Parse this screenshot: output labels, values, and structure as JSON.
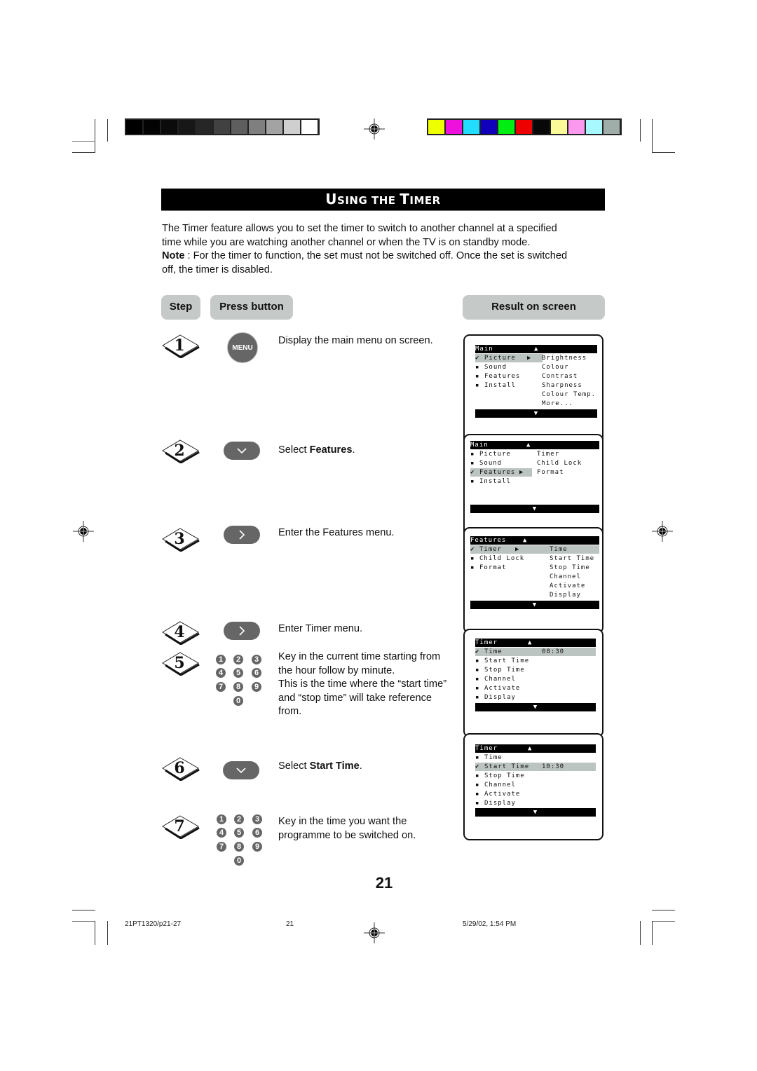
{
  "print_marks": {
    "grayscale_swatches": [
      "#000000",
      "#030303",
      "#0b0b0b",
      "#171717",
      "#262626",
      "#414141",
      "#5e5e5e",
      "#7f7f7f",
      "#a3a3a3",
      "#cfcfcf",
      "#ffffff"
    ],
    "color_swatches": [
      "#eeff00",
      "#ee11dd",
      "#22ddff",
      "#1100bb",
      "#00ee11",
      "#ee0000",
      "#080808",
      "#fafa99",
      "#fa99ee",
      "#a8f8ff",
      "#a0aeaa"
    ]
  },
  "title": {
    "first_cap": "U",
    "first_rest": "SING THE ",
    "second_cap": "T",
    "second_rest": "IMER"
  },
  "intro": {
    "line1": "The Timer feature allows you to set the timer to switch to another channel at a specified",
    "line2": "time while you are watching another channel or when the TV is on standby mode.",
    "note_label": "Note",
    "note_text": " : For the timer to function, the set must not be switched off. Once the set is switched",
    "line4": "off, the timer is disabled."
  },
  "headers": {
    "step": "Step",
    "press_button": "Press button",
    "result": "Result on screen"
  },
  "steps": [
    {
      "num": "1",
      "button": "MENU",
      "button_icon": "menu-button",
      "text": "Display the main menu on screen."
    },
    {
      "num": "2",
      "button_icon": "down-chevron",
      "text_pre": "Select ",
      "text_bold": "Features",
      "text_post": "."
    },
    {
      "num": "3",
      "button_icon": "right-chevron",
      "text": "Enter the Features menu."
    },
    {
      "num": "4",
      "button_icon": "right-chevron",
      "text": "Enter Timer menu."
    },
    {
      "num": "5",
      "button_icon": "number-keypad",
      "lines": [
        "Key in the current time starting from",
        "the hour follow by minute.",
        "This is the time where the “start time”",
        "and “stop time” will take reference",
        "from."
      ]
    },
    {
      "num": "6",
      "button_icon": "down-chevron",
      "text_pre": "Select ",
      "text_bold": "Start Time",
      "text_post": "."
    },
    {
      "num": "7",
      "button_icon": "number-keypad",
      "lines": [
        "Key in the time you want the",
        "programme to be switched on."
      ]
    }
  ],
  "keypad": {
    "keys": [
      "1",
      "2",
      "3",
      "4",
      "5",
      "6",
      "7",
      "8",
      "9",
      "0"
    ]
  },
  "screens": [
    {
      "title": "Main",
      "up": "▲",
      "down": "▼",
      "left": [
        {
          "mark": "✔",
          "label": "Picture",
          "selected": true
        },
        {
          "mark": "▪",
          "label": "Sound"
        },
        {
          "mark": "▪",
          "label": "Features"
        },
        {
          "mark": "▪",
          "label": "Install"
        }
      ],
      "right": [
        "Brightness",
        "Colour",
        "Contrast",
        "Sharpness",
        "Colour Temp.",
        "More..."
      ],
      "arrow": "▶"
    },
    {
      "title": "Main",
      "up": "▲",
      "down": "▼",
      "left": [
        {
          "mark": "▪",
          "label": "Picture"
        },
        {
          "mark": "▪",
          "label": "Sound"
        },
        {
          "mark": "✔",
          "label": "Features",
          "selected": true
        },
        {
          "mark": "▪",
          "label": "Install"
        }
      ],
      "right": [
        "Timer",
        "Child Lock",
        "Format"
      ],
      "arrow": "▶"
    },
    {
      "title": "Features",
      "up": "▲",
      "down": "▼",
      "left": [
        {
          "mark": "✔",
          "label": "Timer",
          "selected": true
        },
        {
          "mark": "▪",
          "label": "Child Lock"
        },
        {
          "mark": "▪",
          "label": "Format"
        }
      ],
      "right": [
        "Time",
        "Start Time",
        "Stop Time",
        "Channel",
        "Activate",
        "Display"
      ],
      "arrow": "▶"
    },
    {
      "title": "Timer",
      "up": "▲",
      "down": "▼",
      "rows": [
        {
          "mark": "✔",
          "label": "Time",
          "value": "08:30",
          "selected": true
        },
        {
          "mark": "▪",
          "label": "Start Time"
        },
        {
          "mark": "▪",
          "label": "Stop Time"
        },
        {
          "mark": "▪",
          "label": "Channel"
        },
        {
          "mark": "▪",
          "label": "Activate"
        },
        {
          "mark": "▪",
          "label": "Display"
        }
      ]
    },
    {
      "title": "Timer",
      "up": "▲",
      "down": "▼",
      "rows": [
        {
          "mark": "▪",
          "label": "Time"
        },
        {
          "mark": "✔",
          "label": "Start Time",
          "value": "10:30",
          "selected": true
        },
        {
          "mark": "▪",
          "label": "Stop Time"
        },
        {
          "mark": "▪",
          "label": "Channel"
        },
        {
          "mark": "▪",
          "label": "Activate"
        },
        {
          "mark": "▪",
          "label": "Display"
        }
      ]
    }
  ],
  "page_number": "21",
  "footer": {
    "file": "21PT1320/p21-27",
    "page": "21",
    "date": "5/29/02, 1:54 PM"
  }
}
